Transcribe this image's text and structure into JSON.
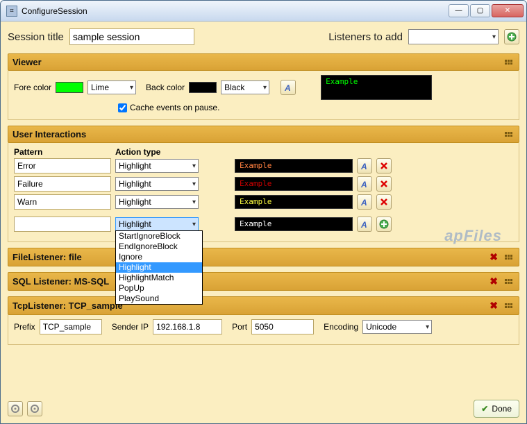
{
  "window": {
    "title": "ConfigureSession"
  },
  "top": {
    "session_title_label": "Session title",
    "session_title_value": "sample session",
    "listeners_label": "Listeners to add",
    "listeners_value": ""
  },
  "viewer": {
    "header": "Viewer",
    "fore_label": "Fore color",
    "fore_swatch": "#00ff00",
    "fore_value": "Lime",
    "back_label": "Back color",
    "back_swatch": "#000000",
    "back_value": "Black",
    "cache_label": "Cache events on pause.",
    "cache_checked": true,
    "preview_text": "Example"
  },
  "user_interactions": {
    "header": "User Interactions",
    "col_pattern": "Pattern",
    "col_action": "Action type",
    "rows": [
      {
        "pattern": "Error",
        "action": "Highlight",
        "preview": "Example",
        "preview_color": "#ff8040"
      },
      {
        "pattern": "Failure",
        "action": "Highlight",
        "preview": "Example",
        "preview_color": "#cc0000"
      },
      {
        "pattern": "Warn",
        "action": "Highlight",
        "preview": "Example",
        "preview_color": "#ffff40"
      }
    ],
    "new_row": {
      "pattern": "",
      "action": "Highlight",
      "preview": "Example",
      "preview_color": "#ffffff",
      "options": [
        "StartIgnoreBlock",
        "EndIgnoreBlock",
        "Ignore",
        "Highlight",
        "HighlightMatch",
        "PopUp",
        "PlaySound"
      ],
      "selected": "Highlight"
    }
  },
  "file_listener": {
    "header": "FileListener: file"
  },
  "sql_listener": {
    "header": "SQL Listener: MS-SQL"
  },
  "tcp_listener": {
    "header": "TcpListener: TCP_sample",
    "prefix_label": "Prefix",
    "prefix_value": "TCP_sample",
    "sender_label": "Sender IP",
    "sender_value": "192.168.1.8",
    "port_label": "Port",
    "port_value": "5050",
    "encoding_label": "Encoding",
    "encoding_value": "Unicode"
  },
  "footer": {
    "done": "Done"
  },
  "watermark": "apFiles"
}
